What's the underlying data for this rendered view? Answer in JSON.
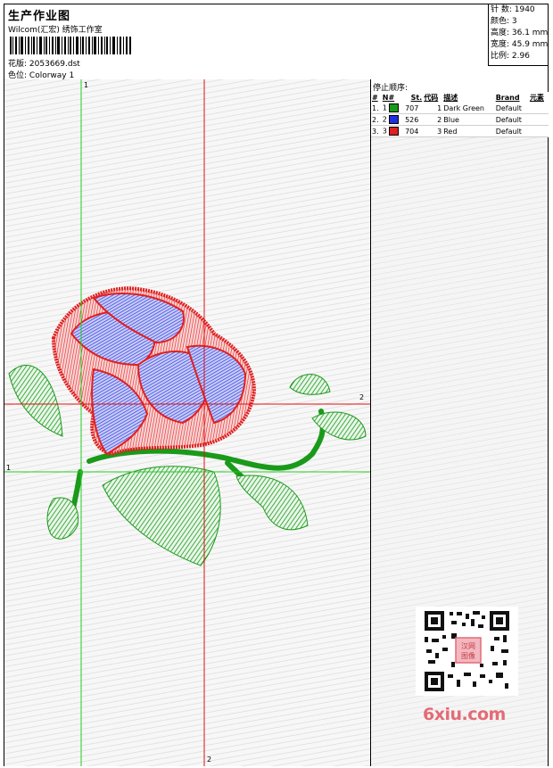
{
  "header": {
    "title": "生产作业图",
    "company": "Wilcom(汇宏) 绣饰工作室",
    "design_label": "花版:",
    "design_file": "2053669.dst",
    "colorway_label": "色位:",
    "colorway_value": "Colorway 1"
  },
  "stats": {
    "stitches": "针 数: 1940",
    "colors": "颜色: 3",
    "height": "高度: 36.1 mm",
    "width": "宽度: 45.9 mm",
    "scale": "比例: 2.96"
  },
  "stop_sequence": {
    "title": "停止顺序:",
    "headers": [
      "#",
      "N#",
      "St.",
      "代码",
      "描述",
      "Brand",
      "元素"
    ],
    "rows": [
      {
        "index": "1.",
        "needle": "1",
        "color": "#1a9a1a",
        "stitch": "707",
        "code": "1",
        "desc": "Dark Green",
        "brand": "Default"
      },
      {
        "index": "2.",
        "needle": "2",
        "color": "#1f2ee0",
        "stitch": "526",
        "code": "2",
        "desc": "Blue",
        "brand": "Default"
      },
      {
        "index": "3.",
        "needle": "3",
        "color": "#e01f1f",
        "stitch": "704",
        "code": "3",
        "desc": "Red",
        "brand": "Default"
      }
    ]
  },
  "guides": {
    "v1": "1",
    "v2": "2",
    "h1": "1",
    "h2": "2"
  },
  "watermark": "6xiu.com",
  "qr_badge": "汉网图像",
  "colors": {
    "green_guide": "#22cc22",
    "red_guide": "#e01010",
    "thread_green": "#1a9a1a",
    "thread_blue": "#1f2ee0",
    "thread_red": "#e01f1f"
  }
}
